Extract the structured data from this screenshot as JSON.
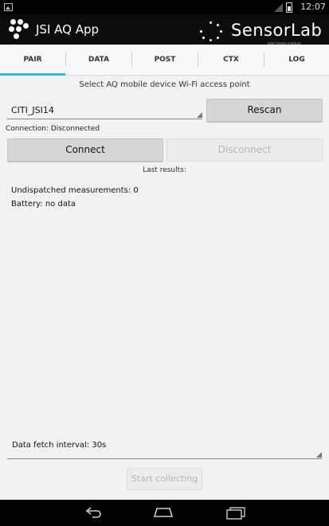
{
  "status_bar": {
    "time": "12:07",
    "icons": [
      "image-icon",
      "signal-icon",
      "battery-icon"
    ]
  },
  "action_bar": {
    "app_title": "JSI AQ App",
    "brand_name": "SensorLab",
    "brand_subtitle": "Jožef Stefan Institute"
  },
  "tabs": [
    {
      "label": "PAIR",
      "selected": true
    },
    {
      "label": "DATA",
      "selected": false
    },
    {
      "label": "POST",
      "selected": false
    },
    {
      "label": "CTX",
      "selected": false
    },
    {
      "label": "LOG",
      "selected": false
    }
  ],
  "pair": {
    "heading": "Select AQ mobile device Wi-Fi access point",
    "access_point": "CITI_JSI14",
    "rescan_label": "Rescan",
    "connection_status": "Connection: Disconnected",
    "connect_label": "Connect",
    "disconnect_label": "Disconnect",
    "last_results_heading": "Last results:",
    "undispatched": "Undispatched measurements: 0",
    "battery": "Battery: no data",
    "fetch_interval": "Data fetch interval: 30s",
    "start_label": "Start collecting"
  },
  "colors": {
    "accent": "#33b5e5",
    "action_bar": "#0c0c0c",
    "background": "#f2f2f2"
  }
}
